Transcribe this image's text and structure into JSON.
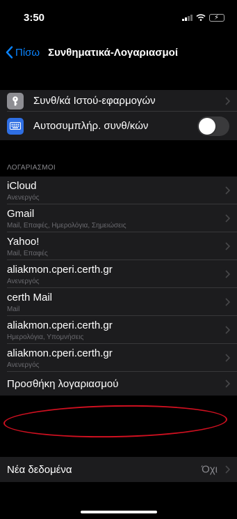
{
  "status_bar": {
    "time": "3:50"
  },
  "nav": {
    "back_label": "Πίσω",
    "title": "Συνθηματικά-Λογαριασμοί"
  },
  "group1": {
    "web_passwords": "Συνθ/κά Ιστού-εφαρμογών",
    "autofill": "Αυτοσυμπλήρ. συνθ/κών",
    "autofill_enabled": false
  },
  "accounts": {
    "header": "ΛΟΓΑΡΙΑΣΜΟΙ",
    "items": [
      {
        "name": "iCloud",
        "detail": "Ανενεργός"
      },
      {
        "name": "Gmail",
        "detail": "Mail, Επαφές, Ημερολόγια, Σημειώσεις"
      },
      {
        "name": "Yahoo!",
        "detail": "Mail, Επαφές"
      },
      {
        "name": "aliakmon.cperi.certh.gr",
        "detail": "Ανενεργός"
      },
      {
        "name": "certh Mail",
        "detail": "Mail"
      },
      {
        "name": "aliakmon.cperi.certh.gr",
        "detail": "Ημερολόγια, Υπομνήσεις"
      },
      {
        "name": "aliakmon.cperi.certh.gr",
        "detail": "Ανενεργός"
      }
    ],
    "add_account": "Προσθήκη λογαριασμού"
  },
  "fetch": {
    "label": "Νέα δεδομένα",
    "value": "Όχι"
  },
  "colors": {
    "accent": "#0a84ff",
    "annotation": "#d01020"
  }
}
